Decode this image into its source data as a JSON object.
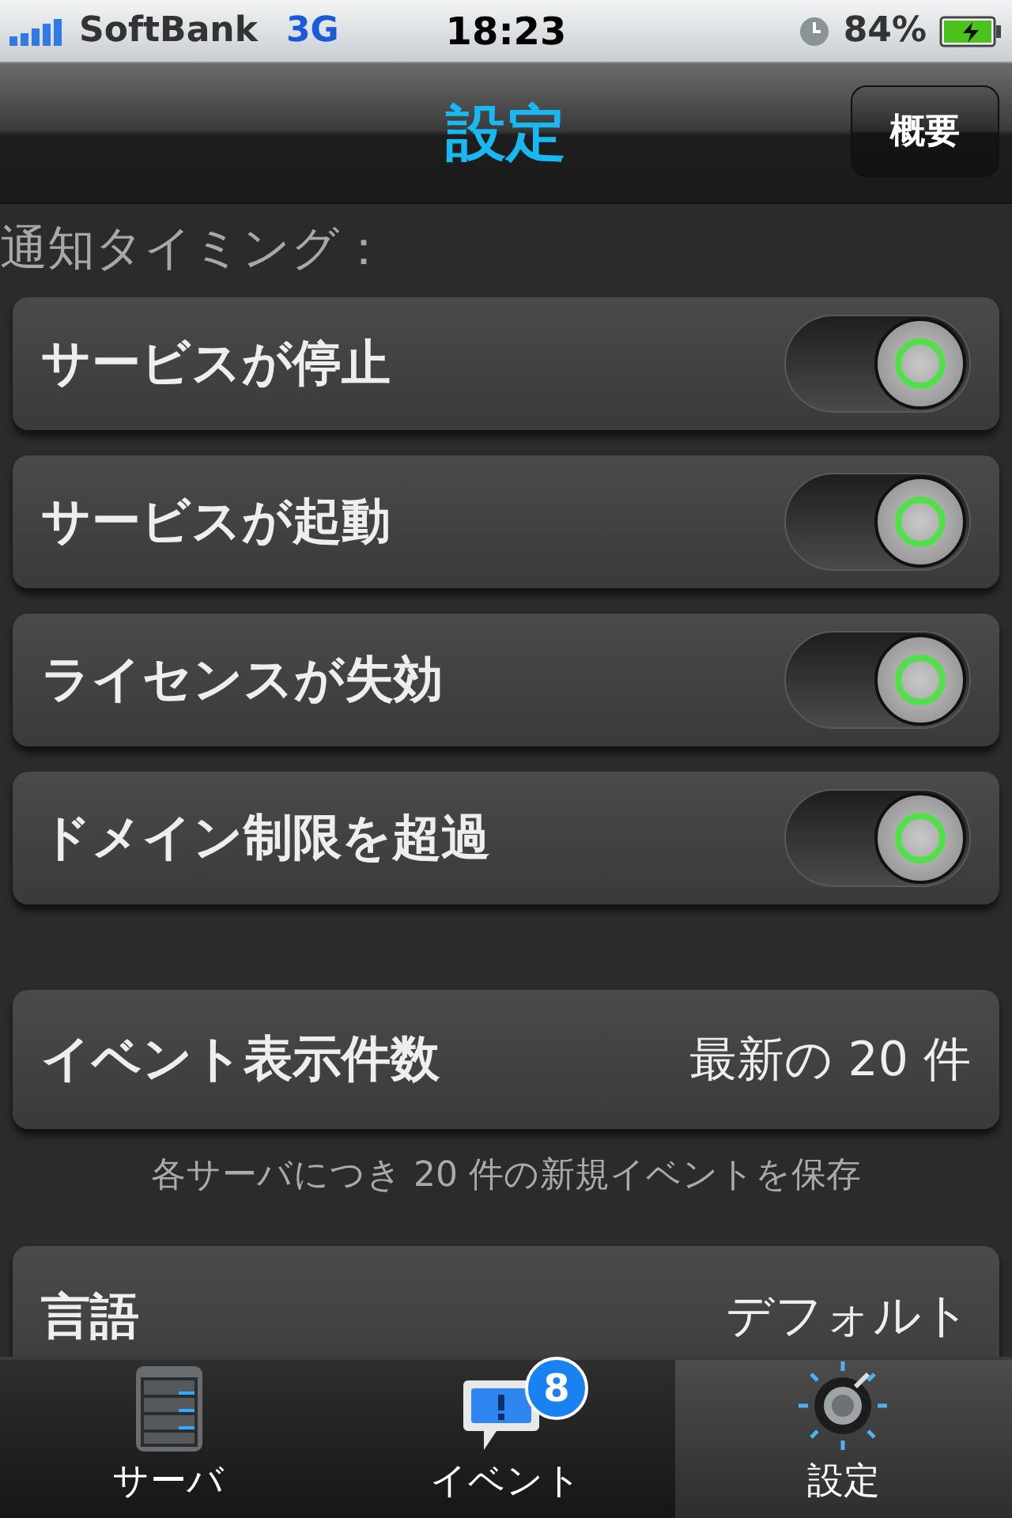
{
  "status_bar": {
    "carrier": "SoftBank",
    "network": "3G",
    "time": "18:23",
    "battery": "84%"
  },
  "nav": {
    "title": "設定",
    "button": "概要"
  },
  "notify_section": {
    "header": "通知タイミング：",
    "items": [
      {
        "label": "サービスが停止",
        "on": true
      },
      {
        "label": "サービスが起動",
        "on": true
      },
      {
        "label": "ライセンスが失効",
        "on": true
      },
      {
        "label": "ドメイン制限を超過",
        "on": true
      }
    ]
  },
  "event_count": {
    "label": "イベント表示件数",
    "value": "最新の 20 件",
    "note": "各サーバにつき 20 件の新規イベントを保存"
  },
  "language": {
    "label": "言語",
    "value": "デフォルト"
  },
  "tab_bar": [
    {
      "label": "サーバ",
      "kind": "server",
      "selected": false
    },
    {
      "label": "イベント",
      "kind": "event",
      "badge": "8",
      "selected": false
    },
    {
      "label": "設定",
      "kind": "settings",
      "selected": true
    }
  ]
}
